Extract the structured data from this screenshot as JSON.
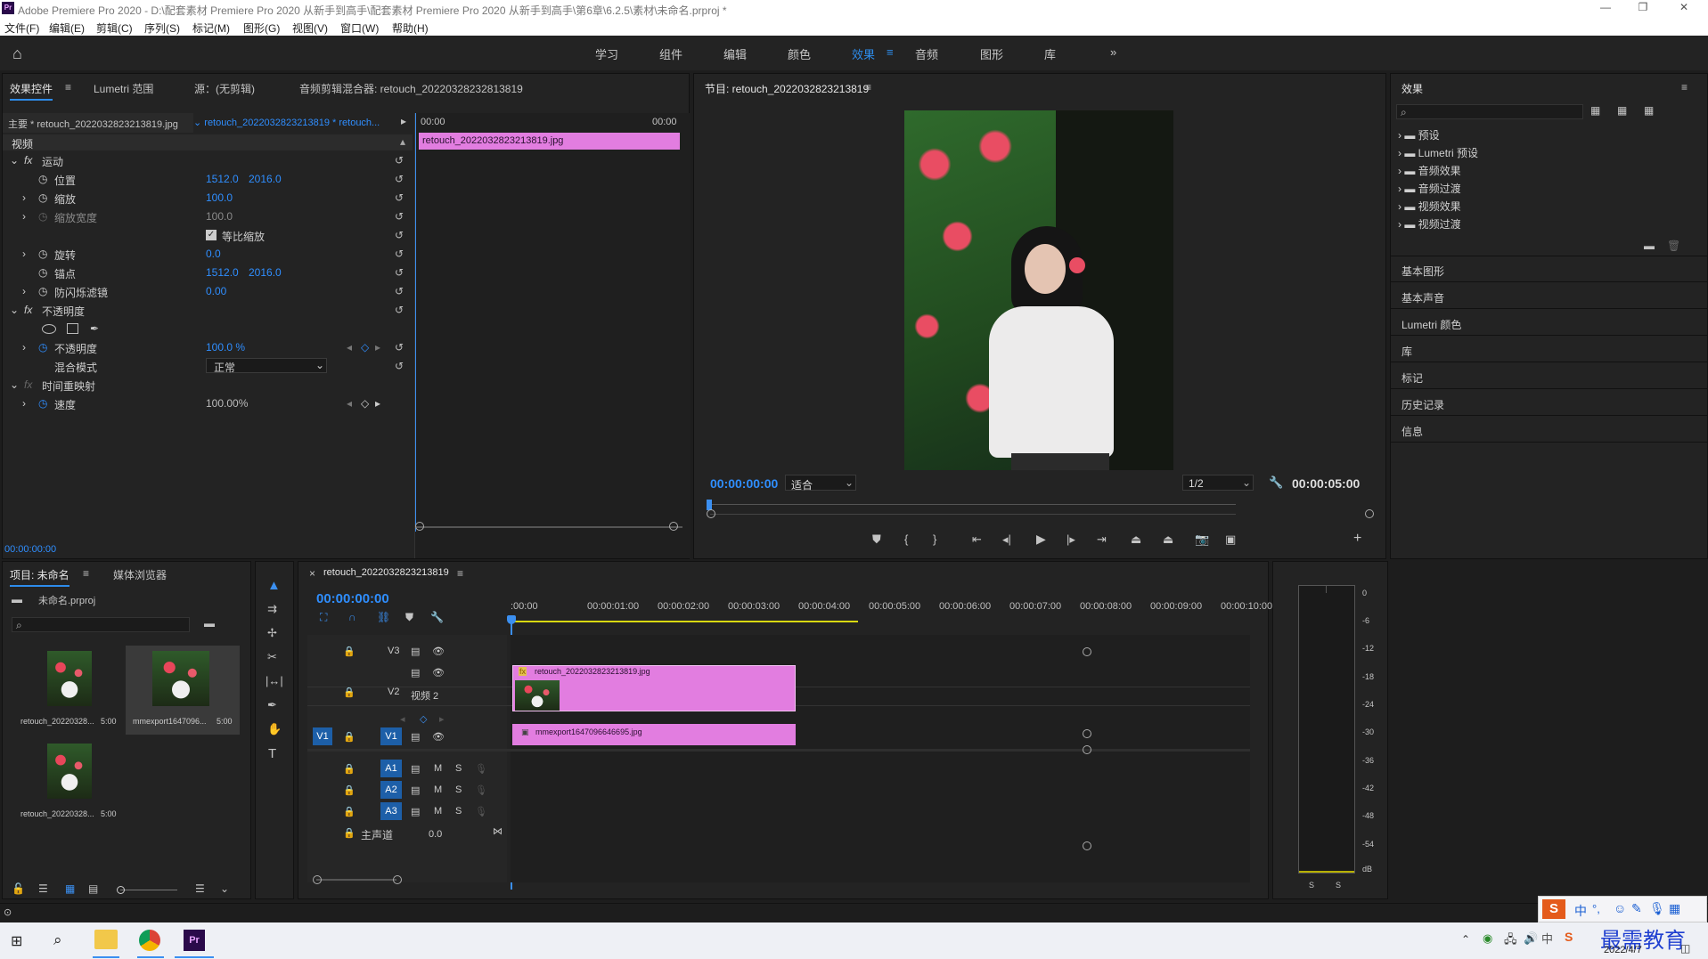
{
  "window": {
    "app_badge": "Pr",
    "title": "Adobe Premiere Pro 2020 - D:\\配套素材 Premiere Pro 2020 从新手到高手\\配套素材 Premiere Pro 2020 从新手到高手\\第6章\\6.2.5\\素材\\未命名.prproj *"
  },
  "menu": [
    "文件(F)",
    "编辑(E)",
    "剪辑(C)",
    "序列(S)",
    "标记(M)",
    "图形(G)",
    "视图(V)",
    "窗口(W)",
    "帮助(H)"
  ],
  "workspaces": [
    "学习",
    "组件",
    "编辑",
    "颜色",
    "效果",
    "音频",
    "图形",
    "库"
  ],
  "workspace_active": "效果",
  "effect_controls": {
    "tabs": [
      "效果控件",
      "Lumetri 范围",
      "源：(无剪辑)",
      "音频剪辑混合器: retouch_20220328232813819"
    ],
    "master_label": "主要 * retouch_2022032823213819.jpg",
    "sequence_label": "retouch_2022032823213819 * retouch...",
    "time_start": "00:00",
    "time_end": "00:00",
    "clip_name": "retouch_2022032823213819.jpg",
    "section_video": "视频",
    "motion": "运动",
    "position_label": "位置",
    "position_x": "1512.0",
    "position_y": "2016.0",
    "scale_label": "缩放",
    "scale_val": "100.0",
    "scale_width_label": "缩放宽度",
    "scale_width_val": "100.0",
    "uniform_label": "等比缩放",
    "rotation_label": "旋转",
    "rotation_val": "0.0",
    "anchor_label": "锚点",
    "anchor_x": "1512.0",
    "anchor_y": "2016.0",
    "flicker_label": "防闪烁滤镜",
    "flicker_val": "0.00",
    "opacity_section": "不透明度",
    "opacity_label": "不透明度",
    "opacity_val": "100.0 %",
    "blend_label": "混合模式",
    "blend_val": "正常",
    "time_remap": "时间重映射",
    "speed_label": "速度",
    "speed_val": "100.00%",
    "timecode": "00:00:00:00"
  },
  "program": {
    "title": "节目: retouch_2022032823213819",
    "timecode": "00:00:00:00",
    "fit": "适合",
    "res": "1/2",
    "duration": "00:00:05:00"
  },
  "effects_panel": {
    "title": "效果",
    "items": [
      "预设",
      "Lumetri 预设",
      "音频效果",
      "音频过渡",
      "视频效果",
      "视频过渡"
    ],
    "sections": [
      "基本图形",
      "基本声音",
      "Lumetri 颜色",
      "库",
      "标记",
      "历史记录",
      "信息"
    ]
  },
  "project": {
    "tabs": [
      "项目: 未命名",
      "媒体浏览器"
    ],
    "file": "未命名.prproj",
    "items": [
      {
        "name": "retouch_20220328...",
        "dur": "5:00"
      },
      {
        "name": "mmexport1647096...",
        "dur": "5:00"
      },
      {
        "name": "retouch_20220328...",
        "dur": "5:00"
      }
    ]
  },
  "timeline": {
    "tab": "retouch_2022032823213819",
    "timecode": "00:00:00:00",
    "ruler": [
      ":00:00",
      "00:00:01:00",
      "00:00:02:00",
      "00:00:03:00",
      "00:00:04:00",
      "00:00:05:00",
      "00:00:06:00",
      "00:00:07:00",
      "00:00:08:00",
      "00:00:09:00",
      "00:00:10:00",
      "0"
    ],
    "tracks_video": [
      "V3",
      "V2",
      "V1"
    ],
    "v2_name": "视频 2",
    "v1_src": "V1",
    "tracks_audio": [
      "A1",
      "A2",
      "A3"
    ],
    "master": "主声道",
    "master_val": "0.0",
    "clip_top": "retouch_2022032823213819.jpg",
    "clip_bottom": "mmexport1647096646695.jpg",
    "fx_badge": "fx",
    "m": "M",
    "s": "S"
  },
  "meter": {
    "labels": [
      "0",
      "-6",
      "-12",
      "-18",
      "-24",
      "-30",
      "-36",
      "-42",
      "-48",
      "-54",
      "dB"
    ],
    "solo": [
      "S",
      "S"
    ]
  },
  "taskbar": {
    "date": "2022/4/7",
    "watermark": "最需教育",
    "ime": [
      "中",
      "°,"
    ]
  },
  "colors": {
    "accent": "#2d8ceb",
    "clip_pink": "#e27de0",
    "playhead": "#3b8ff0"
  }
}
